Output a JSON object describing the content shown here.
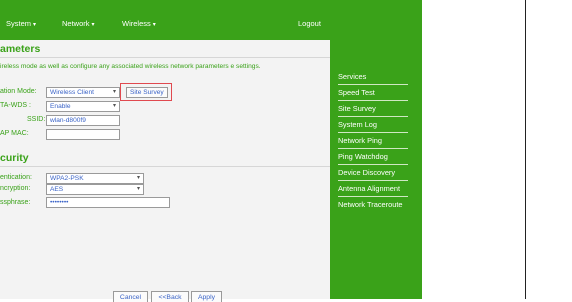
{
  "topnav": {
    "items": [
      {
        "label": "System"
      },
      {
        "label": "Network"
      },
      {
        "label": "Wireless"
      }
    ],
    "logout_label": "Logout"
  },
  "content": {
    "params_title": "ameters",
    "description": "ireless mode as well as configure any associated wireless network parameters e settings.",
    "fields": {
      "operation_mode": {
        "label": "ation Mode:",
        "value": "Wireless Client"
      },
      "wds": {
        "label": "TA-WDS :",
        "value": "Enable"
      },
      "ssid": {
        "label": "SSID:",
        "value": "wlan-d800f9"
      },
      "ap_mac": {
        "label": "AP MAC:",
        "value": ""
      }
    },
    "site_survey_label": "Site Survey",
    "security_title": "curity",
    "security": {
      "authentication": {
        "label": "entication:",
        "value": "WPA2-PSK"
      },
      "encryption": {
        "label": "ncryption:",
        "value": "AES"
      },
      "passphrase": {
        "label": "ssphrase:",
        "value": "••••••••"
      }
    },
    "buttons": {
      "cancel": "Cancel",
      "back": "<<Back",
      "apply": "Apply"
    }
  },
  "sidebar": {
    "items": [
      {
        "label": "Services"
      },
      {
        "label": "Speed Test"
      },
      {
        "label": "Site Survey"
      },
      {
        "label": "System Log"
      },
      {
        "label": "Network Ping"
      },
      {
        "label": "Ping Watchdog"
      },
      {
        "label": "Device Discovery"
      },
      {
        "label": "Antenna Alignment"
      },
      {
        "label": "Network Traceroute"
      }
    ]
  },
  "colors": {
    "brand_green": "#3aa219",
    "panel_bg": "#f3f3f3",
    "highlight_red": "#e0494f",
    "field_text_blue": "#3a63c7"
  }
}
